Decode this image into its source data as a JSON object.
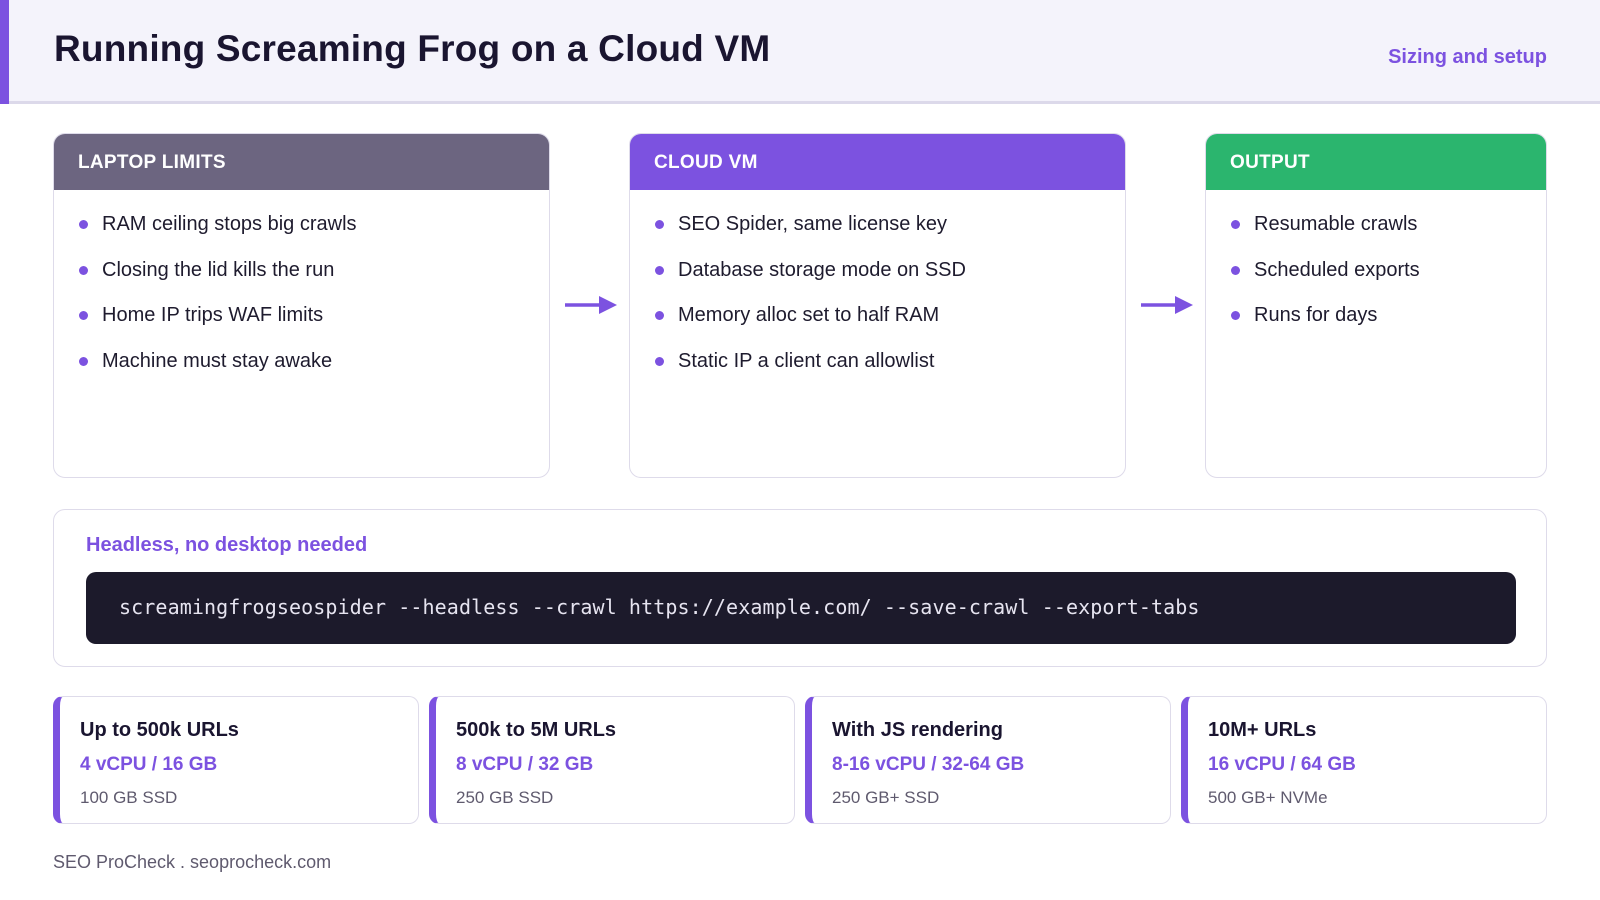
{
  "header": {
    "title": "Running Screaming Frog on a Cloud VM",
    "subtitle": "Sizing and setup"
  },
  "flow": [
    {
      "heading": "LAPTOP LIMITS",
      "color": "#6c6580",
      "items": [
        "RAM ceiling stops big crawls",
        "Closing the lid kills the run",
        "Home IP trips WAF limits",
        "Machine must stay awake"
      ]
    },
    {
      "heading": "CLOUD VM",
      "color": "#7c52e0",
      "items": [
        "SEO Spider, same license key",
        "Database storage mode on SSD",
        "Memory alloc set to half RAM",
        "Static IP a client can allowlist"
      ]
    },
    {
      "heading": "OUTPUT",
      "color": "#2bb56e",
      "items": [
        "Resumable crawls",
        "Scheduled exports",
        "Runs for days"
      ]
    }
  ],
  "command": {
    "title": "Headless, no desktop needed",
    "code": "screamingfrogseospider --headless --crawl https://example.com/ --save-crawl --export-tabs"
  },
  "tiers": [
    {
      "name": "Up to 500k URLs",
      "spec": "4 vCPU / 16 GB",
      "disk": "100 GB SSD"
    },
    {
      "name": "500k to 5M URLs",
      "spec": "8 vCPU / 32 GB",
      "disk": "250 GB SSD"
    },
    {
      "name": "With JS rendering",
      "spec": "8-16 vCPU / 32-64 GB",
      "disk": "250 GB+ SSD"
    },
    {
      "name": "10M+ URLs",
      "spec": "16 vCPU / 64 GB",
      "disk": "500 GB+ NVMe"
    }
  ],
  "footer": "SEO ProCheck . seoprocheck.com",
  "colors": {
    "accent": "#7c52e0",
    "terminal_bg": "#1c1a2b"
  }
}
